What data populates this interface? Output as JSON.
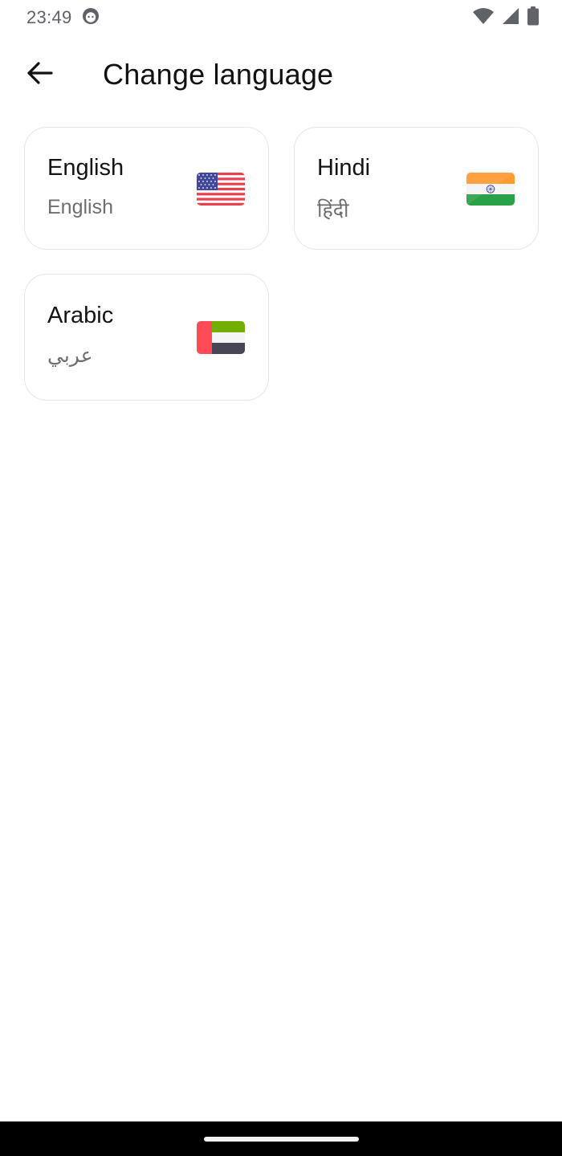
{
  "status_bar": {
    "time": "23:49",
    "notification_icon": "android-face-icon",
    "icons": [
      "wifi-icon",
      "cell-signal-icon",
      "battery-icon"
    ]
  },
  "app_bar": {
    "back_icon": "arrow-left-icon",
    "title": "Change language"
  },
  "languages": [
    {
      "name": "English",
      "native": "English",
      "flag": "us-flag-icon"
    },
    {
      "name": "Hindi",
      "native": "हिंदी",
      "flag": "india-flag-icon"
    },
    {
      "name": "Arabic",
      "native": "عربي",
      "flag": "uae-flag-icon"
    }
  ],
  "colors": {
    "background": "#ffffff",
    "card_border": "#e6e6e6",
    "title_text": "#111111",
    "secondary_text": "#6e6e6e",
    "nav_bar": "#000000"
  }
}
